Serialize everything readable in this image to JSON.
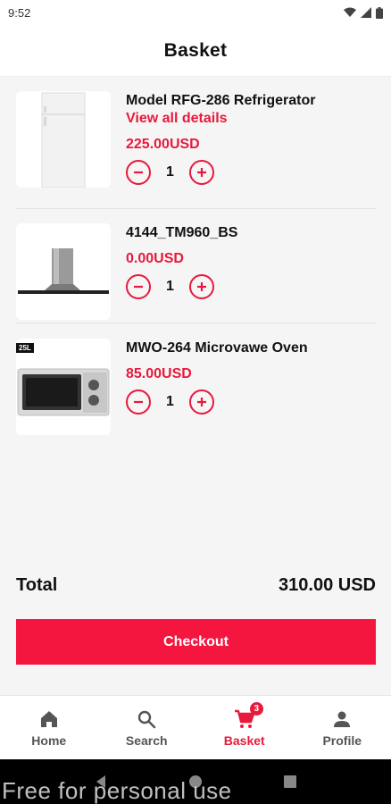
{
  "status_bar": {
    "time": "9:52"
  },
  "header": {
    "title": "Basket"
  },
  "items": [
    {
      "name": "Model RFG-286 Refrigerator",
      "link": "View all details",
      "price": "225.00USD",
      "quantity": "1"
    },
    {
      "name": "4144_TM960_BS",
      "price": "0.00USD",
      "quantity": "1"
    },
    {
      "name": "MWO-264 Microvawe Oven",
      "price": "85.00USD",
      "quantity": "1",
      "thumb_badge": "25L"
    }
  ],
  "total": {
    "label": "Total",
    "value": "310.00 USD"
  },
  "checkout": {
    "label": "Checkout"
  },
  "nav": {
    "home": "Home",
    "search": "Search",
    "basket": "Basket",
    "basket_count": "3",
    "profile": "Profile"
  },
  "watermark": "Free for personal use",
  "colors": {
    "accent": "#e8193c",
    "checkout": "#f4163e",
    "background": "#f5f5f5"
  }
}
